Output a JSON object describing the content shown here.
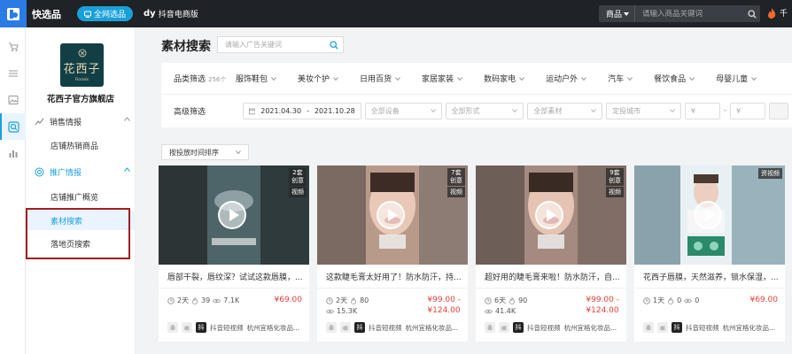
{
  "topbar": {
    "brand": "快选品",
    "pill_label": "全网选品",
    "douyin_prefix": "dy",
    "douyin_label": "抖音电商版",
    "search_category": "商品",
    "search_placeholder": "请输入商品关键词",
    "user_name": "千"
  },
  "sidebar": {
    "shop_logo_cn": "花西子",
    "shop_logo_en": "Florasis",
    "shop_name": "花西子官方旗舰店",
    "groups": [
      {
        "label": "销售情报",
        "items": [
          {
            "label": "店铺热销商品"
          }
        ]
      },
      {
        "label": "推广情报",
        "items": [
          {
            "label": "店铺推广概览"
          },
          {
            "label": "素材搜索"
          },
          {
            "label": "落地页搜索"
          }
        ]
      }
    ]
  },
  "main": {
    "title": "素材搜索",
    "search_placeholder": "请输入广告关键词",
    "filters": {
      "category_label": "品类筛选",
      "category_count": "256个",
      "categories": [
        "服饰鞋包",
        "美妆个护",
        "日用百货",
        "家居家装",
        "数码家电",
        "运动户外",
        "汽车",
        "餐饮食品",
        "母婴儿童"
      ],
      "advanced_label": "高级筛选",
      "date_start": "2021.04.30",
      "date_sep": "-",
      "date_end": "2021.10.28",
      "device": "全部设备",
      "format": "全部形式",
      "material": "全部素材",
      "city": "定投城市",
      "price_symbol": "¥",
      "price_sep": "-"
    },
    "sort_label": "按投放时间排序"
  },
  "cards": [
    {
      "tag_top": "2套",
      "tag_bottom": "创意",
      "tag_type": "视频",
      "title": "唇部干裂，唇纹深？试试这款唇膜，...",
      "days": "2天",
      "likes": "39",
      "views": "7.1K",
      "views2": "",
      "price_a": "¥69.00",
      "price_b": "",
      "platform": "抖音短视频",
      "company": "杭州宜格化妆品..."
    },
    {
      "tag_top": "7套",
      "tag_bottom": "创意",
      "tag_type": "视频",
      "title": "这款睫毛膏太好用了！防水防汗，持...",
      "days": "2天",
      "likes": "80",
      "views": "",
      "views2": "15.3K",
      "price_a": "¥99.00 -",
      "price_b": "¥124.00",
      "platform": "抖音短视频",
      "company": "杭州宜格化妆品..."
    },
    {
      "tag_top": "9套",
      "tag_bottom": "创意",
      "tag_type": "视频",
      "title": "超好用的睫毛膏来啦！防水防汗，自...",
      "days": "6天",
      "likes": "90",
      "views": "",
      "views2": "41.4K",
      "price_a": "¥99.00 -",
      "price_b": "¥124.00",
      "platform": "抖音短视频",
      "company": "杭州宜格化妆品..."
    },
    {
      "tag_top": "",
      "tag_bottom": "",
      "tag_type": "资视频",
      "title": "花西子唇膜，天然滋养，锁水保湿，...",
      "days": "1天",
      "likes": "0",
      "views": "0",
      "views2": "",
      "price_a": "¥69.00",
      "price_b": "",
      "platform": "抖音短视频",
      "company": "杭州宜格化妆品..."
    }
  ]
}
